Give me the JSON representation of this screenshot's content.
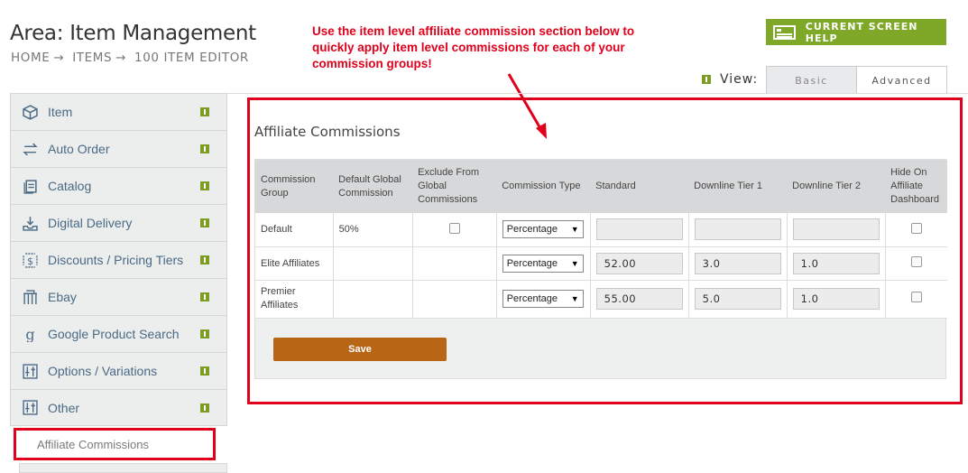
{
  "header": {
    "area_title": "Area: Item Management",
    "breadcrumb": [
      "HOME",
      "ITEMS",
      "100 ITEM EDITOR"
    ],
    "separator": "→",
    "help_button": "CURRENT SCREEN HELP",
    "view_label": "View:",
    "view_tabs": [
      "Basic",
      "Advanced"
    ]
  },
  "annotation": "Use the item level affiliate commission section below to quickly apply item level commissions for each of your commission groups!",
  "sidebar": {
    "items": [
      {
        "label": "Item",
        "icon": "box-icon"
      },
      {
        "label": "Auto Order",
        "icon": "repeat-icon"
      },
      {
        "label": "Catalog",
        "icon": "catalog-icon"
      },
      {
        "label": "Digital Delivery",
        "icon": "download-icon"
      },
      {
        "label": "Discounts / Pricing Tiers",
        "icon": "dollar-icon"
      },
      {
        "label": "Ebay",
        "icon": "ebay-icon"
      },
      {
        "label": "Google Product Search",
        "icon": "google-icon"
      },
      {
        "label": "Options / Variations",
        "icon": "sliders-icon"
      },
      {
        "label": "Other",
        "icon": "sliders-icon"
      }
    ],
    "active_sub": "Affiliate Commissions"
  },
  "panel": {
    "title": "Affiliate Commissions",
    "columns": [
      "Commission Group",
      "Default Global Commission",
      "Exclude From Global Commissions",
      "Commission Type",
      "Standard",
      "Downline Tier 1",
      "Downline Tier 2",
      "Hide On Affiliate Dashboard"
    ],
    "rows": [
      {
        "group": "Default",
        "default_global": "50%",
        "type": "Percentage",
        "standard": "",
        "tier1": "",
        "tier2": ""
      },
      {
        "group": "Elite Affiliates",
        "default_global": "",
        "type": "Percentage",
        "standard": "52.00",
        "tier1": "3.0",
        "tier2": "1.0"
      },
      {
        "group": "Premier Affiliates",
        "default_global": "",
        "type": "Percentage",
        "standard": "55.00",
        "tier1": "5.0",
        "tier2": "1.0"
      }
    ],
    "save_label": "Save"
  },
  "colors": {
    "annotation_red": "#e0001b",
    "help_green": "#7fa829",
    "save_brown": "#b86516"
  }
}
